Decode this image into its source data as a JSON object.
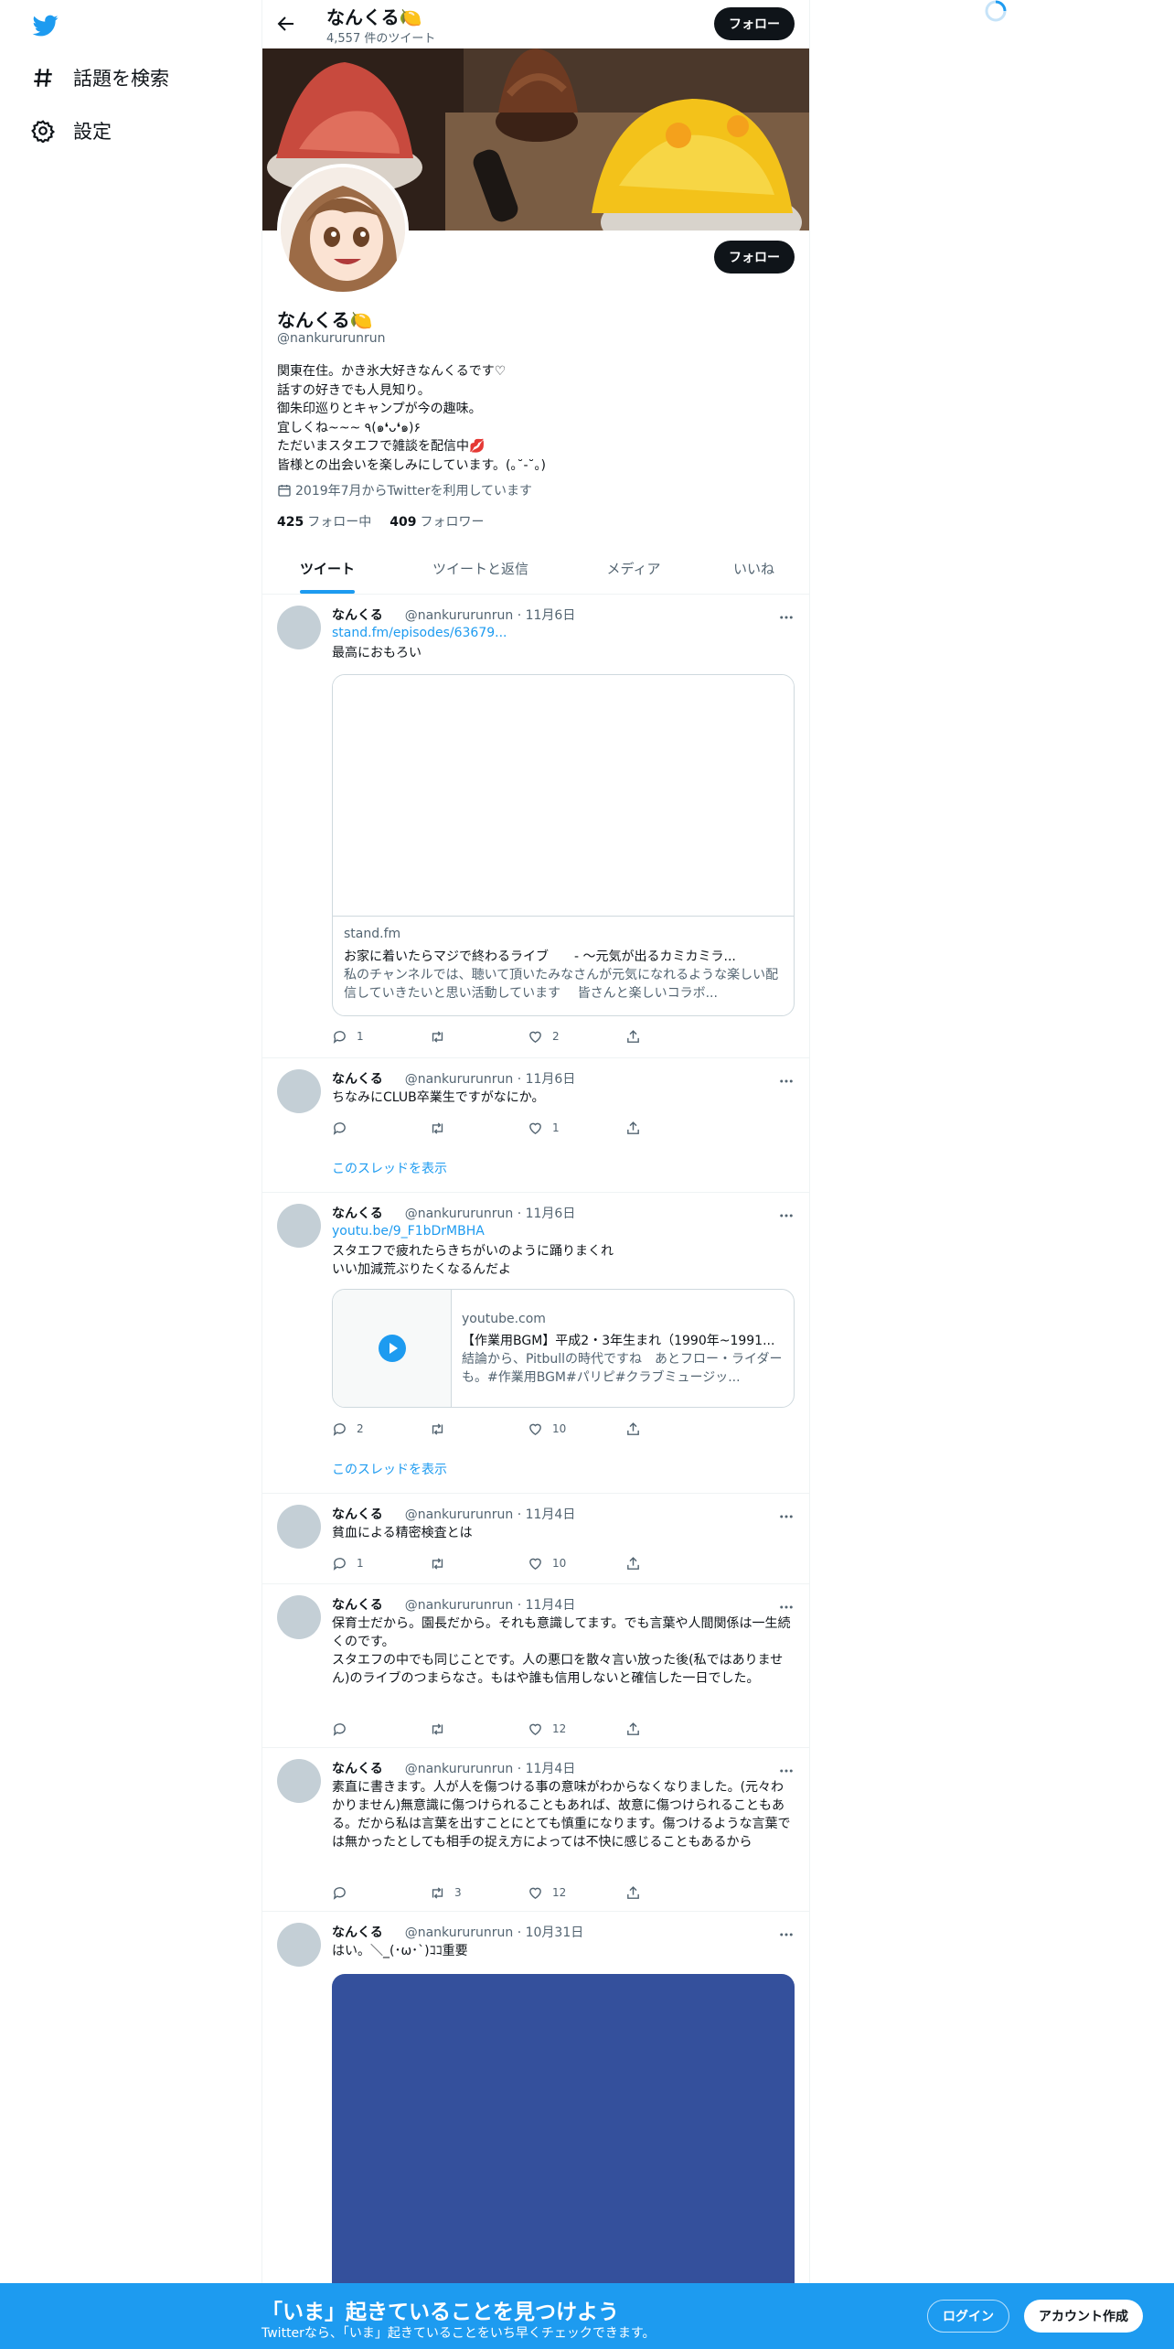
{
  "colors": {
    "accent": "#1d9bf0",
    "text": "#0f1419",
    "muted": "#536471",
    "banner_bar": "#1d9bf0"
  },
  "nav": {
    "logo_icon": "twitter-bird-icon",
    "items": [
      {
        "label": "話題を検索",
        "icon": "hashtag-icon"
      },
      {
        "label": "設定",
        "icon": "gear-icon"
      }
    ]
  },
  "header": {
    "name": "なんくる🍋",
    "tweet_count": "4,557 件のツイート",
    "follow_label": "フォロー"
  },
  "profile": {
    "name": "なんくる🍋",
    "handle": "@nankururunrun",
    "follow_label": "フォロー",
    "bio": "関東在住。かき氷大好きなんくるです♡\n話すの好きでも人見知り。\n御朱印巡りとキャンプが今の趣味。\n宜しくね~~~ ٩(๑❛ᴗ❛๑)۶\nただいまスタエフで雑談を配信中💋\n皆様との出会いを楽しみにしています。(｡˘-˘｡)",
    "joined": "2019年7月からTwitterを利用しています",
    "following_count": "425",
    "following_label": "フォロー中",
    "followers_count": "409",
    "followers_label": "フォロワー"
  },
  "tabs": [
    {
      "label": "ツイート",
      "active": true
    },
    {
      "label": "ツイートと返信",
      "active": false
    },
    {
      "label": "メディア",
      "active": false
    },
    {
      "label": "いいね",
      "active": false
    }
  ],
  "tweets": [
    {
      "name": "なんくる",
      "handle_date": "@nankururunrun · 11月6日",
      "link": "stand.fm/episodes/63679...",
      "text": "最高におもろい",
      "card": {
        "domain": "stand.fm",
        "title": "お家に着いたらマジで終わるライブ　　- ～元気が出るカミカミラ...",
        "desc": "私のチャンネルでは、聴いて頂いたみなさんが元気になれるような楽しい配信していきたいと思い活動しています　 皆さんと楽しいコラボ..."
      },
      "replies": "1",
      "retweets": "",
      "likes": "2"
    },
    {
      "name": "なんくる",
      "handle_date": "@nankururunrun · 11月6日",
      "text": "ちなみにCLUB卒業生ですがなにか。",
      "replies": "",
      "retweets": "",
      "likes": "1",
      "show_thread": "このスレッドを表示"
    },
    {
      "name": "なんくる",
      "handle_date": "@nankururunrun · 11月6日",
      "link": "youtu.be/9_F1bDrMBHA",
      "text": "スタエフで疲れたらきちがいのように踊りまくれ\nいい加減荒ぶりたくなるんだよ",
      "card": {
        "domain": "youtube.com",
        "title": "【作業用BGM】平成2・3年生まれ（1990年~1991...",
        "desc": "結論から、Pitbullの時代ですね　あとフロー・ライダーも。#作業用BGM#パリピ#クラブミュージッ..."
      },
      "replies": "2",
      "retweets": "",
      "likes": "10",
      "show_thread": "このスレッドを表示"
    },
    {
      "name": "なんくる",
      "handle_date": "@nankururunrun · 11月4日",
      "text": "貧血による精密検査とは",
      "replies": "1",
      "retweets": "",
      "likes": "10"
    },
    {
      "name": "なんくる",
      "handle_date": "@nankururunrun · 11月4日",
      "text": "保育士だから。園長だから。それも意識してます。でも言葉や人間関係は一生続くのです。\nスタエフの中でも同じことです。人の悪口を散々言い放った後(私ではありません)のライブのつまらなさ。もはや誰も信用しないと確信した一日でした。",
      "replies": "",
      "retweets": "",
      "likes": "12"
    },
    {
      "name": "なんくる",
      "handle_date": "@nankururunrun · 11月4日",
      "text": "素直に書きます。人が人を傷つける事の意味がわからなくなりました。(元々わかりません)無意識に傷つけられることもあれば、故意に傷つけられることもある。だから私は言葉を出すことにとても慎重になります。傷つけるような言葉では無かったとしても相手の捉え方によっては不快に感じることもあるから",
      "replies": "",
      "retweets": "3",
      "likes": "12"
    },
    {
      "name": "なんくる",
      "handle_date": "@nankururunrun · 10月31日",
      "text": "はい。＼_(･ω･`)ｺｺ重要"
    }
  ],
  "bottom_bar": {
    "title": "「いま」起きていることを見つけよう",
    "subtitle": "Twitterなら、「いま」起きていることをいち早くチェックできます。",
    "login_label": "ログイン",
    "signup_label": "アカウント作成"
  }
}
